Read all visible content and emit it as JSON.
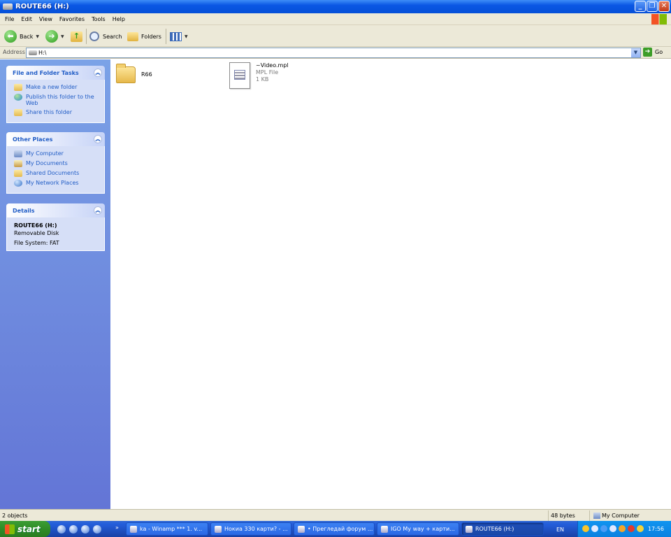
{
  "window": {
    "title": "ROUTE66 (H:)",
    "minimize": "_",
    "restore": "❐",
    "close": "✕"
  },
  "menu": [
    "File",
    "Edit",
    "View",
    "Favorites",
    "Tools",
    "Help"
  ],
  "toolbar": {
    "back": "Back",
    "forward_arrow": "➔",
    "back_arrow": "⬅",
    "search": "Search",
    "folders": "Folders"
  },
  "address": {
    "label": "Address",
    "value": "H:\\",
    "go": "Go"
  },
  "panels": {
    "tasks": {
      "title": "File and Folder Tasks",
      "items": [
        "Make a new folder",
        "Publish this folder to the Web",
        "Share this folder"
      ]
    },
    "places": {
      "title": "Other Places",
      "items": [
        "My Computer",
        "My Documents",
        "Shared Documents",
        "My Network Places"
      ]
    },
    "details": {
      "title": "Details",
      "name": "ROUTE66 (H:)",
      "type": "Removable Disk",
      "fs": "File System: FAT"
    }
  },
  "files": [
    {
      "name": "R66",
      "icon": "folder-icon"
    },
    {
      "name": "~Video.mpl",
      "type": "MPL File",
      "size": "1 KB",
      "icon": "mpl-file-icon"
    }
  ],
  "status": {
    "objects": "2 objects",
    "size": "48 bytes",
    "location": "My Computer"
  },
  "taskbar": {
    "start": "start",
    "buttons": [
      "ka - Winamp *** 1. v...",
      "Нокиа 330 карти? - ...",
      "• Прегледай форум ...",
      "IGO My way + карти...",
      "ROUTE66 (H:)"
    ],
    "lang": "EN",
    "clock": "17:56"
  },
  "colors": {
    "titlebar": "#0a57e4",
    "sidebar": "#7ba2e7",
    "link": "#215dc6",
    "start": "#3c9e35"
  }
}
